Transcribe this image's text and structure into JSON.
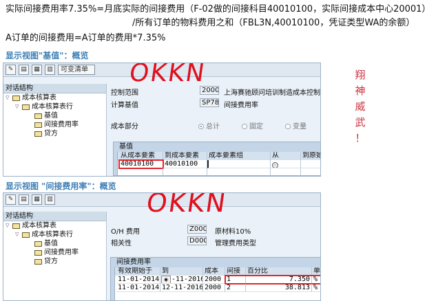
{
  "notes": {
    "line1": "实际间接费用率7.35%=月底实际的间接费用（F-02做的间接科目40010100，实际间接成本中心20001）",
    "line2": "/所有订单的物料费用之和（FBL3N,40010100，凭证类型WA的余额）",
    "line3": "A订单的间接费用=A订单的费用*7.35%"
  },
  "side_text": [
    "翔",
    "神",
    "威",
    "武",
    "！"
  ],
  "panel1": {
    "heading": "显示视图\"基值\"：概览",
    "toolbar": {
      "button_label": "可变清单"
    },
    "handwritten": "OKKN",
    "nav": {
      "header": "对话结构",
      "items": [
        "成本核算表",
        "成本核算表行",
        "基值",
        "间接费用率",
        "贷方"
      ]
    },
    "fields": {
      "control_area_label": "控制范围",
      "control_area_value": "2000",
      "control_area_desc": "上海赛驰顾问培训制造成本控制范围",
      "base_label": "计算基值",
      "base_value": "SP78",
      "base_desc": "间接费用率",
      "cost_part_label": "成本部分",
      "radio_total": "总计",
      "radio_fixed": "固定",
      "radio_variable": "变量"
    },
    "grid": {
      "title": "基值",
      "headers": [
        "从成本要素",
        "到成本要素",
        "成本要素组",
        "从",
        "到原始"
      ],
      "rows": [
        {
          "from": "40010100",
          "to": "40010100",
          "group": ""
        }
      ]
    }
  },
  "panel2": {
    "heading": "显示视图 \"间接费用率\"：概览",
    "handwritten": "OKKN",
    "nav": {
      "header": "对话结构",
      "items": [
        "成本核算表",
        "成本核算表行",
        "基值",
        "间接费用率",
        "贷方"
      ]
    },
    "fields": {
      "oh_label": "O/H 费用",
      "oh_value": "Z000",
      "oh_desc": "原材料10%",
      "dep_label": "相关性",
      "dep_value": "D000",
      "dep_desc": "管理费用类型"
    },
    "grid": {
      "title": "间接费用率",
      "headers": [
        "有效期始于",
        "到",
        "成本",
        "间接",
        "百分比",
        "单位"
      ],
      "rows": [
        {
          "from": "11-01-2014",
          "to": "-11-2016",
          "cost": "2000",
          "ind": "1",
          "pct": "7.350",
          "unit": "%"
        },
        {
          "from": "11-01-2014",
          "to": "12-11-2016",
          "cost": "2000",
          "ind": "2",
          "pct": "38.813",
          "unit": "%"
        }
      ]
    }
  },
  "colors": {
    "heading_blue": "#3d7fb5",
    "annotation_red": "#e0232b",
    "side_text_red": "#c8323c"
  }
}
